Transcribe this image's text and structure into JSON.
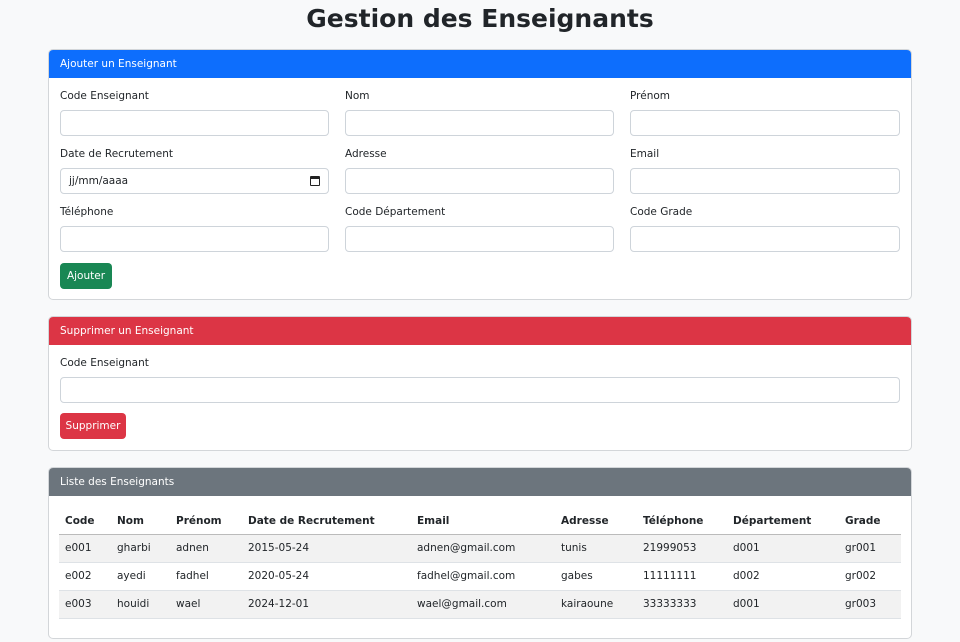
{
  "page_title": "Gestion des Enseignants",
  "add_card": {
    "header": "Ajouter un Enseignant",
    "fields": {
      "code": {
        "label": "Code Enseignant",
        "value": ""
      },
      "nom": {
        "label": "Nom",
        "value": ""
      },
      "prenom": {
        "label": "Prénom",
        "value": ""
      },
      "date": {
        "label": "Date de Recrutement",
        "placeholder": "jj/mm/aaaa"
      },
      "adresse": {
        "label": "Adresse",
        "value": ""
      },
      "email": {
        "label": "Email",
        "value": ""
      },
      "telephone": {
        "label": "Téléphone",
        "value": ""
      },
      "departement": {
        "label": "Code Département",
        "value": ""
      },
      "grade": {
        "label": "Code Grade",
        "value": ""
      }
    },
    "submit_label": "Ajouter"
  },
  "delete_card": {
    "header": "Supprimer un Enseignant",
    "field_label": "Code Enseignant",
    "submit_label": "Supprimer"
  },
  "list_card": {
    "header": "Liste des Enseignants",
    "columns": [
      "Code",
      "Nom",
      "Prénom",
      "Date de Recrutement",
      "Email",
      "Adresse",
      "Téléphone",
      "Département",
      "Grade"
    ],
    "rows": [
      [
        "e001",
        "gharbi",
        "adnen",
        "2015-05-24",
        "adnen@gmail.com",
        "tunis",
        "21999053",
        "d001",
        "gr001"
      ],
      [
        "e002",
        "ayedi",
        "fadhel",
        "2020-05-24",
        "fadhel@gmail.com",
        "gabes",
        "11111111",
        "d002",
        "gr002"
      ],
      [
        "e003",
        "houidi",
        "wael",
        "2024-12-01",
        "wael@gmail.com",
        "kairaoune",
        "33333333",
        "d001",
        "gr003"
      ]
    ]
  },
  "colors": {
    "primary": "#0d6efd",
    "danger": "#dc3545",
    "secondary": "#6c757d",
    "success": "#198754"
  }
}
